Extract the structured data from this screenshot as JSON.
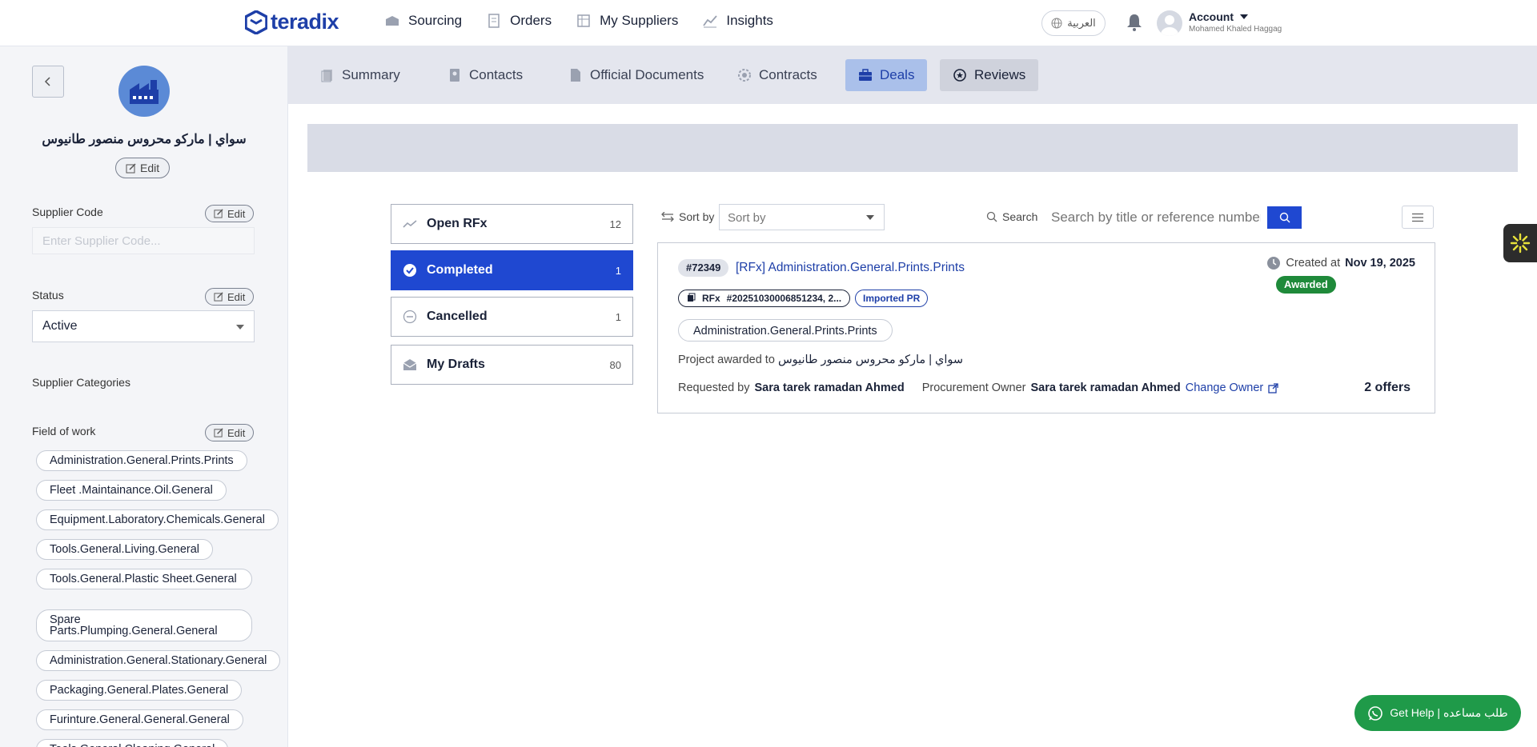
{
  "brand": {
    "name": "teradix"
  },
  "nav": {
    "items": [
      {
        "label": "Sourcing",
        "icon": "sourcing-icon"
      },
      {
        "label": "Orders",
        "icon": "orders-icon"
      },
      {
        "label": "My Suppliers",
        "icon": "suppliers-icon"
      },
      {
        "label": "Insights",
        "icon": "insights-icon"
      }
    ],
    "language": "العربية",
    "account_title": "Account",
    "account_user": "Mohamed Khaled Haggag"
  },
  "supplier": {
    "name": "سواي | ماركو محروس منصور طانيوس",
    "edit": "Edit",
    "code_label": "Supplier Code",
    "code_placeholder": "Enter Supplier Code...",
    "status_label": "Status",
    "status_value": "Active",
    "categories_label": "Supplier Categories",
    "field_label": "Field of work",
    "fields": [
      "Administration.General.Prints.Prints",
      "Fleet .Maintainance.Oil.General",
      "Equipment.Laboratory.Chemicals.General",
      "Tools.General.Living.General",
      "Tools.General.Plastic Sheet.General",
      "Spare Parts.Plumping.General.General",
      "Administration.General.Stationary.General",
      "Packaging.General.Plates.General",
      "Furinture.General.General.General",
      "Tools.General.Cleaning.General"
    ]
  },
  "tabs": [
    {
      "label": "Summary",
      "icon": "summary-icon"
    },
    {
      "label": "Contacts",
      "icon": "contacts-icon"
    },
    {
      "label": "Official Documents",
      "icon": "document-icon"
    },
    {
      "label": "Contracts",
      "icon": "contracts-icon"
    },
    {
      "label": "Deals",
      "icon": "briefcase-icon"
    },
    {
      "label": "Reviews",
      "icon": "reviews-icon"
    }
  ],
  "deal_filters": [
    {
      "label": "Open RFx",
      "count": "12"
    },
    {
      "label": "Completed",
      "count": "1"
    },
    {
      "label": "Cancelled",
      "count": "1"
    },
    {
      "label": "My Drafts",
      "count": "80"
    }
  ],
  "toolbar": {
    "sort_label": "Sort by",
    "sort_placeholder": "Sort by",
    "search_label": "Search",
    "search_placeholder": "Search by title or reference number"
  },
  "deal": {
    "ref": "#72349",
    "title": "[RFx] Administration.General.Prints.Prints",
    "rfx_label": "RFx",
    "rfx_numbers": "#20251030006851234, 2...",
    "pr_label": "Imported PR",
    "category": "Administration.General.Prints.Prints",
    "awarded_prefix": "Project awarded to",
    "awarded_to": "سواي | ماركو محروس منصور طانيوس",
    "requested_by_label": "Requested by",
    "requested_by": "Sara tarek ramadan Ahmed",
    "owner_label": "Procurement Owner",
    "owner": "Sara tarek ramadan Ahmed",
    "change_owner": "Change Owner",
    "created_label": "Created at",
    "created_date": "Nov 19, 2025",
    "status": "Awarded",
    "offers": "2 offers"
  },
  "help": {
    "label": "Get Help | طلب مساعده"
  },
  "colors": {
    "primary": "#1f48d1",
    "brand": "#1e3fa8",
    "success": "#1f9a49"
  }
}
